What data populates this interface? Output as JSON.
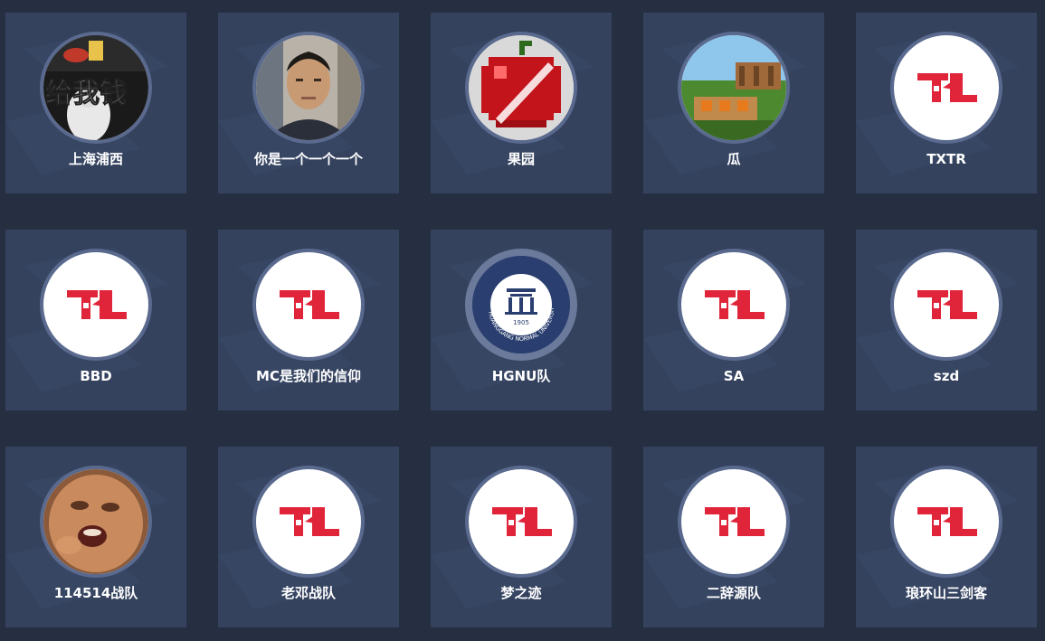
{
  "teams": [
    {
      "name": "上海浦西",
      "avatar": "penguin-meme-avatar"
    },
    {
      "name": "你是一个一个一个",
      "avatar": "person-photo-avatar"
    },
    {
      "name": "果园",
      "avatar": "pixel-apple-avatar"
    },
    {
      "name": "瓜",
      "avatar": "minecraft-garden-avatar"
    },
    {
      "name": "TXTR",
      "avatar": "default-logo-avatar"
    },
    {
      "name": "BBD",
      "avatar": "default-logo-avatar"
    },
    {
      "name": "MC是我们的信仰",
      "avatar": "default-logo-avatar"
    },
    {
      "name": "HGNU队",
      "avatar": "university-seal-avatar",
      "seal_text": "HUANGGANG NORMAL UNIVERSITY",
      "seal_year": "1905"
    },
    {
      "name": "SA",
      "avatar": "default-logo-avatar"
    },
    {
      "name": "szd",
      "avatar": "default-logo-avatar"
    },
    {
      "name": "114514战队",
      "avatar": "face-meme-avatar"
    },
    {
      "name": "老邓战队",
      "avatar": "default-logo-avatar"
    },
    {
      "name": "梦之迹",
      "avatar": "default-logo-avatar"
    },
    {
      "name": "二辞源队",
      "avatar": "default-logo-avatar"
    },
    {
      "name": "琅环山三剑客",
      "avatar": "default-logo-avatar"
    }
  ],
  "meme_caption": "给我钱",
  "colors": {
    "page_bg": "#262f41",
    "card_bg": "#34425e",
    "avatar_ring": "#5a6a8e",
    "logo_red": "#e0243a",
    "text": "#ffffff"
  }
}
